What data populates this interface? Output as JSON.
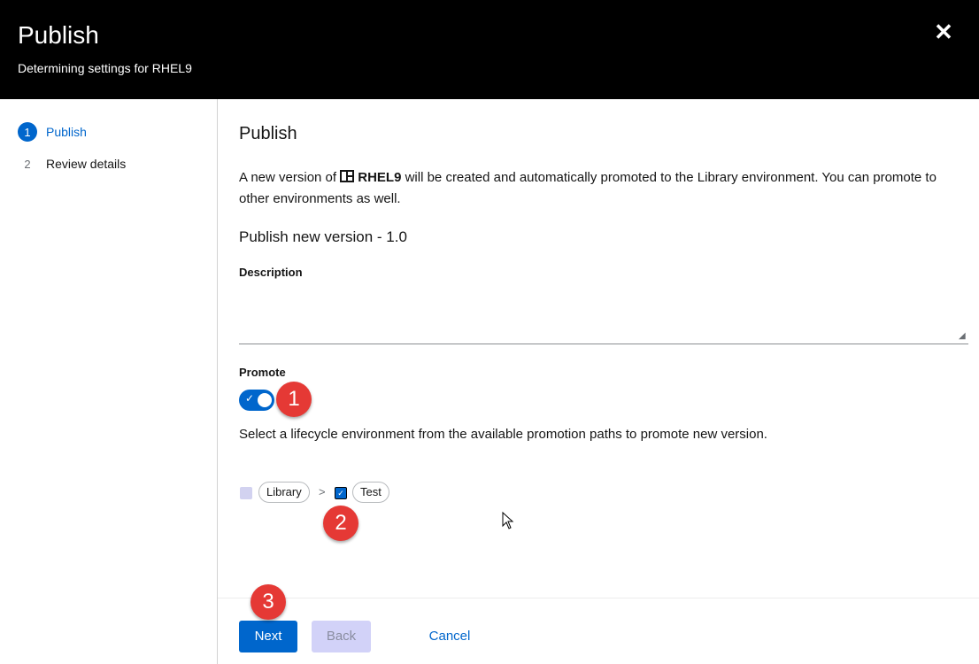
{
  "modal": {
    "title": "Publish",
    "subtitle": "Determining settings for RHEL9",
    "close_icon": "close-icon"
  },
  "wizard_nav": {
    "steps": [
      {
        "num": "1",
        "label": "Publish",
        "active": true
      },
      {
        "num": "2",
        "label": "Review details",
        "active": false
      }
    ]
  },
  "content": {
    "heading": "Publish",
    "intro_prefix": "A new version of ",
    "content_view_icon": "content-view-icon",
    "content_view_name": "RHEL9",
    "intro_suffix": " will be created and automatically promoted to the Library environment. You can promote to other environments as well.",
    "version_heading": "Publish new version - 1.0",
    "description_label": "Description",
    "description_value": "",
    "promote_label": "Promote",
    "promote_enabled": true,
    "promote_helper": "Select a lifecycle environment from the available promotion paths to promote new version.",
    "environments": [
      {
        "name": "Library",
        "checked": true,
        "disabled": true
      },
      {
        "name": "Test",
        "checked": true,
        "disabled": false
      }
    ],
    "path_separator": ">"
  },
  "callouts": [
    "1",
    "2",
    "3"
  ],
  "footer": {
    "next_label": "Next",
    "back_label": "Back",
    "cancel_label": "Cancel"
  },
  "colors": {
    "header_bg": "#000000",
    "accent": "#0066cc",
    "callout": "#e53935"
  }
}
